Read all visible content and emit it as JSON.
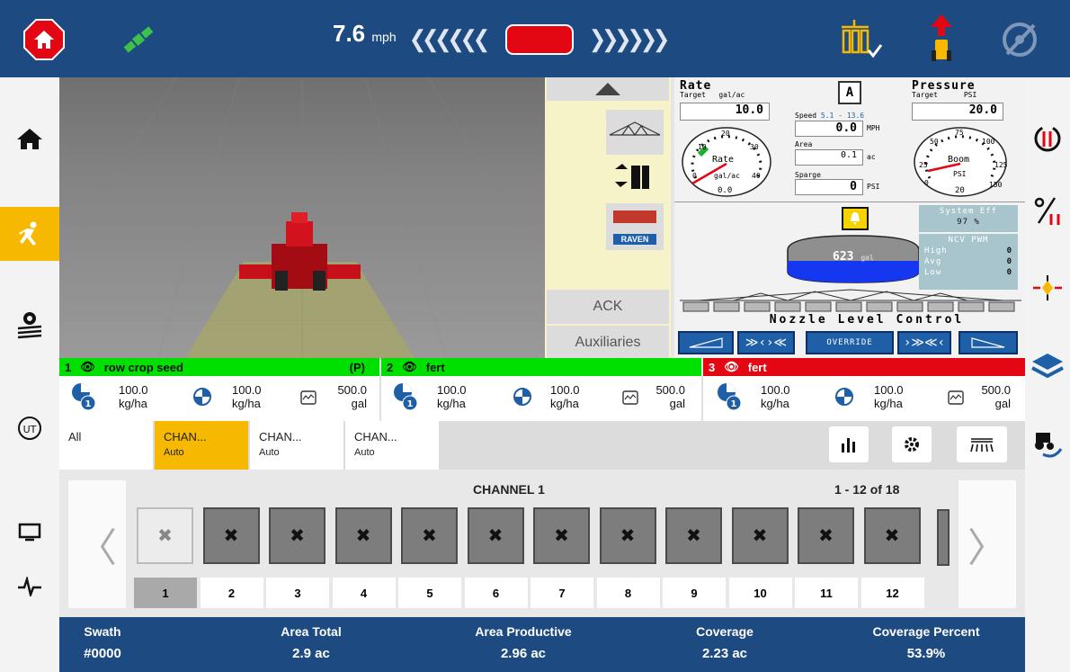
{
  "topbar": {
    "speed_value": "7.6",
    "speed_unit": "mph",
    "left_chevrons": "❮❮❮❮❮❮",
    "right_chevrons": "❯❯❯❯❯❯"
  },
  "colors": {
    "header": "#1d4a80",
    "green": "#00e000",
    "red": "#e30613",
    "accent": "#f6b800"
  },
  "controls": {
    "ack_label": "ACK",
    "aux_label": "Auxiliaries",
    "raven_label": "RAVEN"
  },
  "gauges": {
    "rate": {
      "title": "Rate",
      "target_label": "Target",
      "unit": "gal/ac",
      "value": "10.0",
      "dial_label": "Rate",
      "dial_unit": "gal/ac",
      "dial_reading": "0.0",
      "ticks": [
        "10",
        "20",
        "30",
        "40",
        "0"
      ]
    },
    "pressure": {
      "title": "Pressure",
      "target_label": "Target",
      "unit": "PSI",
      "value": "20.0",
      "dial_label": "Boom",
      "dial_unit": "PSI",
      "dial_reading": "20",
      "ticks": [
        "25",
        "50",
        "75",
        "100",
        "125",
        "150",
        "0"
      ]
    },
    "speed": {
      "label": "Speed",
      "range": "5.1 - 13.6",
      "value": "0.0",
      "unit": "MPH"
    },
    "area": {
      "label": "Area",
      "value": "0.1",
      "unit": "ac"
    },
    "sparge": {
      "label": "Sparge",
      "value": "0",
      "unit": "PSI"
    },
    "tank": {
      "value": "623",
      "unit": "gal"
    },
    "system_eff": {
      "label": "System Eff",
      "value": "97 %"
    },
    "ncv": {
      "title": "NCV PWM",
      "rows": [
        {
          "label": "High",
          "value": "0"
        },
        {
          "label": "Avg",
          "value": "0"
        },
        {
          "label": "Low",
          "value": "0"
        }
      ]
    },
    "nozzle_label": "Nozzle Level Control",
    "override_label": "OVERRIDE",
    "auto_label": "A"
  },
  "products": [
    {
      "num": "1",
      "name": "row crop seed",
      "flag": "(P)",
      "rate1": "100.0",
      "unit1": "kg/ha",
      "rate2": "100.0",
      "unit2": "kg/ha",
      "tank": "500.0",
      "tank_unit": "gal"
    },
    {
      "num": "2",
      "name": "fert",
      "flag": "",
      "rate1": "100.0",
      "unit1": "kg/ha",
      "rate2": "100.0",
      "unit2": "kg/ha",
      "tank": "500.0",
      "tank_unit": "gal"
    },
    {
      "num": "3",
      "name": "fert",
      "flag": "",
      "rate1": "100.0",
      "unit1": "kg/ha",
      "rate2": "100.0",
      "unit2": "kg/ha",
      "tank": "500.0",
      "tank_unit": "gal"
    }
  ],
  "badge_num": "1",
  "tabs": [
    {
      "label": "All",
      "sub": ""
    },
    {
      "label": "CHAN...",
      "sub": "Auto"
    },
    {
      "label": "CHAN...",
      "sub": "Auto"
    },
    {
      "label": "CHAN...",
      "sub": "Auto"
    }
  ],
  "sections": {
    "channel_title": "CHANNEL 1",
    "page_info": "1 - 12 of 18",
    "numbers": [
      "1",
      "2",
      "3",
      "4",
      "5",
      "6",
      "7",
      "8",
      "9",
      "10",
      "11",
      "12"
    ]
  },
  "footer": [
    {
      "label": "Swath",
      "value": "#0000"
    },
    {
      "label": "Area Total",
      "value": "2.9 ac"
    },
    {
      "label": "Area Productive",
      "value": "2.96 ac"
    },
    {
      "label": "Coverage",
      "value": "2.23 ac"
    },
    {
      "label": "Coverage Percent",
      "value": "53.9%"
    }
  ]
}
